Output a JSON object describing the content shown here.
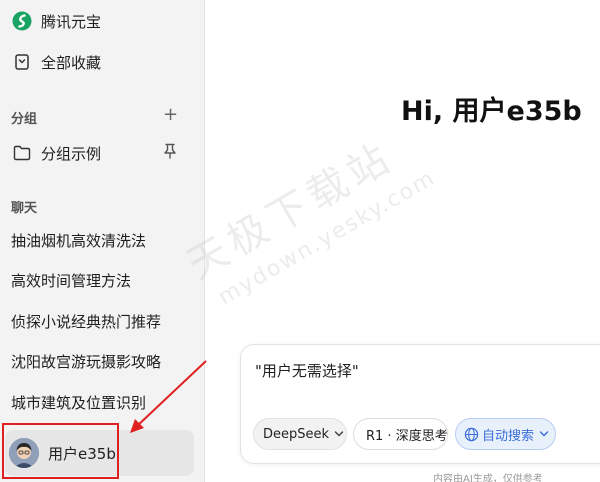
{
  "sidebar": {
    "app_name": "腾讯元宝",
    "favorites_label": "全部收藏",
    "groups_title": "分组",
    "groups_add": "+",
    "group_example": "分组示例",
    "chats_title": "聊天",
    "chats": [
      "抽油烟机高效清洗法",
      "高效时间管理方法",
      "侦探小说经典热门推荐",
      "沈阳故宫游玩摄影攻略",
      "城市建筑及位置识别"
    ],
    "user_name": "用户e35b"
  },
  "main": {
    "greeting": "Hi, 用户e35b",
    "input_text": "\"用户无需选择\"",
    "model_label": "DeepSeek",
    "think_label": "R1 · 深度思考",
    "search_label": "自动搜索",
    "footnote": "内容由AI生成，仅供参考"
  },
  "watermark": {
    "cn": "天极下载站",
    "en": "mydown.yesky.com"
  },
  "colors": {
    "accent_green": "#19a463",
    "search_blue": "#3b6fd6",
    "annotation_red": "#e02020"
  },
  "icons": {
    "logo": "yuanbao-logo-icon",
    "favorites": "bookmark-icon",
    "folder": "folder-icon",
    "pin": "pin-icon",
    "globe": "globe-icon",
    "chevron": "chevron-down-icon"
  }
}
